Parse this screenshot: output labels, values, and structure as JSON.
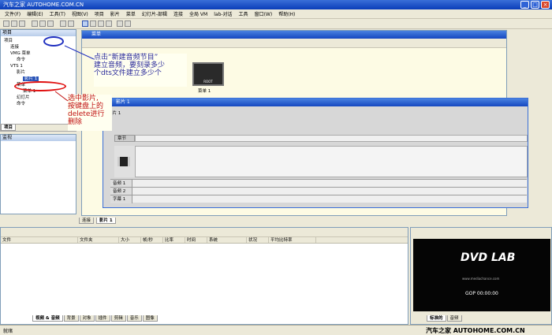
{
  "app": {
    "title": "汽车之家 AUTOHOME.COM.CN"
  },
  "menu": [
    "文件(F)",
    "编辑(E)",
    "工具(T)",
    "视图(V)",
    "项目",
    "影片",
    "菜单",
    "幻灯片-部辑",
    "连接",
    "全局 VM",
    "lab-对话",
    "工具",
    "窗口(W)",
    "帮助(H)"
  ],
  "project_panel": {
    "header": "项目",
    "tree": [
      "项目",
      "连接",
      "VMG 菜单",
      "命令",
      "VTS 1",
      "影片",
      "影片 1",
      "菜单",
      "菜单 1",
      "幻灯片",
      "命令"
    ],
    "tab": "项目"
  },
  "monitor_panel": {
    "header": "监视"
  },
  "menu_window": {
    "title": "菜单",
    "thumb_label": "ROOT",
    "thumb_caption": "菜单 1"
  },
  "movie_window": {
    "title": "影片 1",
    "subtitle": "影片 1",
    "chapter_label": "章节",
    "tracks": [
      "音频 1",
      "音频 2",
      "字幕 1"
    ]
  },
  "annotations": {
    "top": [
      "点击“新建音频节目”",
      "建立音频，要刻录多少",
      "个dts文件建立多少个"
    ],
    "left": [
      "选中影片,",
      "按键盘上的",
      "delete进行",
      "删除"
    ]
  },
  "mdi_tabs": [
    "连接",
    "影片 1"
  ],
  "asset_panel": {
    "columns": [
      "文件",
      "文件夹",
      "大小",
      "帧/秒",
      "比率",
      "时间",
      "系统",
      "状况",
      "平均比特率"
    ],
    "tabs": [
      "视频 & 音频",
      "背景",
      "对象",
      "插件",
      "剪辑",
      "音乐",
      "图像"
    ]
  },
  "preview": {
    "logo": "DVD LAB",
    "url": "www.mediachance.com",
    "timecode": "GOP 00:00:00",
    "tabs": [
      "标准的",
      "音频"
    ]
  },
  "status": {
    "left": "就绪",
    "watermark": "汽车之家 AUTOHOME.COM.CN"
  }
}
